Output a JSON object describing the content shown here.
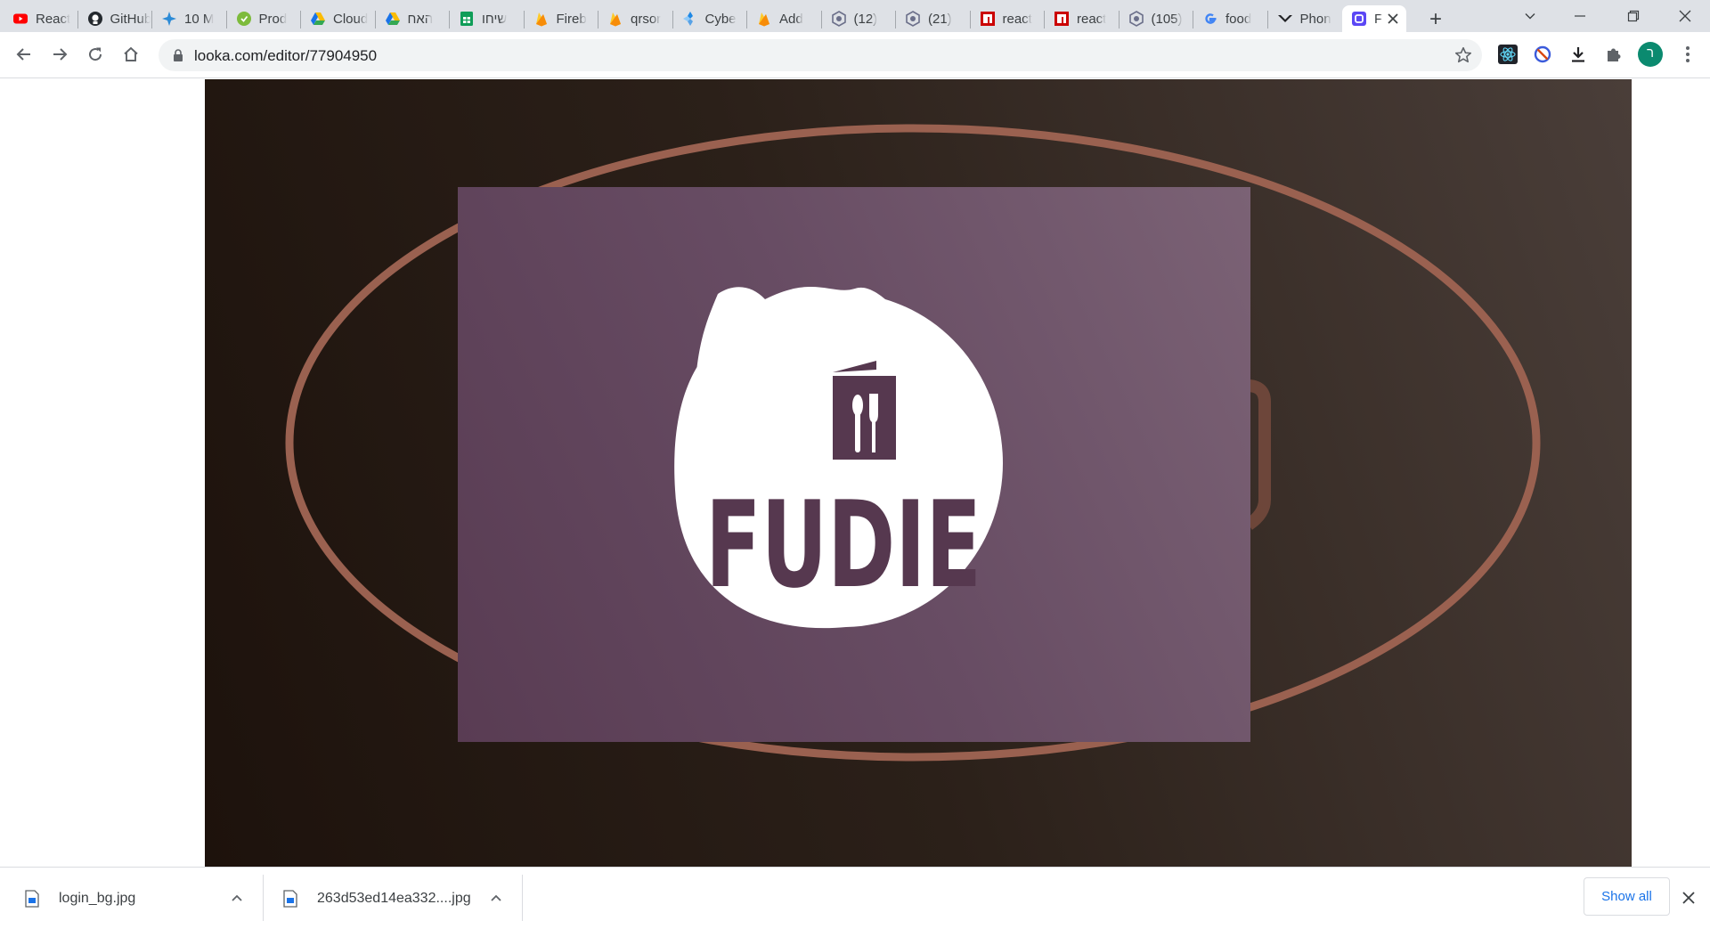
{
  "window": {
    "tabs": [
      {
        "title": "React",
        "icon": "youtube-icon",
        "color": "#ff0000"
      },
      {
        "title": "GitHub",
        "icon": "github-icon",
        "color": "#24292e"
      },
      {
        "title": "10 M",
        "icon": "puzzle-app-icon",
        "color": "#2b8ad6"
      },
      {
        "title": "Prod",
        "icon": "green-circle-icon",
        "color": "#7dbb3c"
      },
      {
        "title": "Cloud",
        "icon": "google-drive-icon",
        "color": "#34a853"
      },
      {
        "title": "האח",
        "icon": "google-drive-icon",
        "color": "#34a853"
      },
      {
        "title": "שיחו",
        "icon": "google-sheets-icon",
        "color": "#0f9d58"
      },
      {
        "title": "Fireb",
        "icon": "firebase-icon",
        "color": "#ffca28"
      },
      {
        "title": "qrsor",
        "icon": "firebase-icon",
        "color": "#ffca28"
      },
      {
        "title": "Cybe",
        "icon": "diamond-app-icon",
        "color": "#1e88e5"
      },
      {
        "title": "Add",
        "icon": "firebase-icon",
        "color": "#ffca28"
      },
      {
        "title": "(12)",
        "icon": "hex-app-icon",
        "color": "#6b6f8a"
      },
      {
        "title": "(21)",
        "icon": "hex-app-icon",
        "color": "#6b6f8a"
      },
      {
        "title": "react",
        "icon": "npm-icon",
        "color": "#cb0000"
      },
      {
        "title": "react",
        "icon": "npm-icon",
        "color": "#cb0000"
      },
      {
        "title": "(105)",
        "icon": "hex-app-icon",
        "color": "#6b6f8a"
      },
      {
        "title": "food",
        "icon": "google-icon",
        "color": "#4285f4"
      },
      {
        "title": "Phon",
        "icon": "chevron-logo-icon",
        "color": "#202124"
      },
      {
        "title": "F",
        "icon": "looka-icon",
        "color": "#5b47f5",
        "active": true
      }
    ],
    "new_tab_label": "+"
  },
  "toolbar": {
    "url": "looka.com/editor/77904950",
    "profile_initial": "ר",
    "profile_color": "#0b8a6f"
  },
  "logo": {
    "brand_name": "FUDIE",
    "brand_color": "#56384f",
    "accent_ring_color": "#9a6150",
    "card_color": "#674c63"
  },
  "downloads": {
    "items": [
      {
        "name": "login_bg.jpg"
      },
      {
        "name": "263d53ed14ea332....jpg"
      }
    ],
    "show_all_label": "Show all"
  }
}
